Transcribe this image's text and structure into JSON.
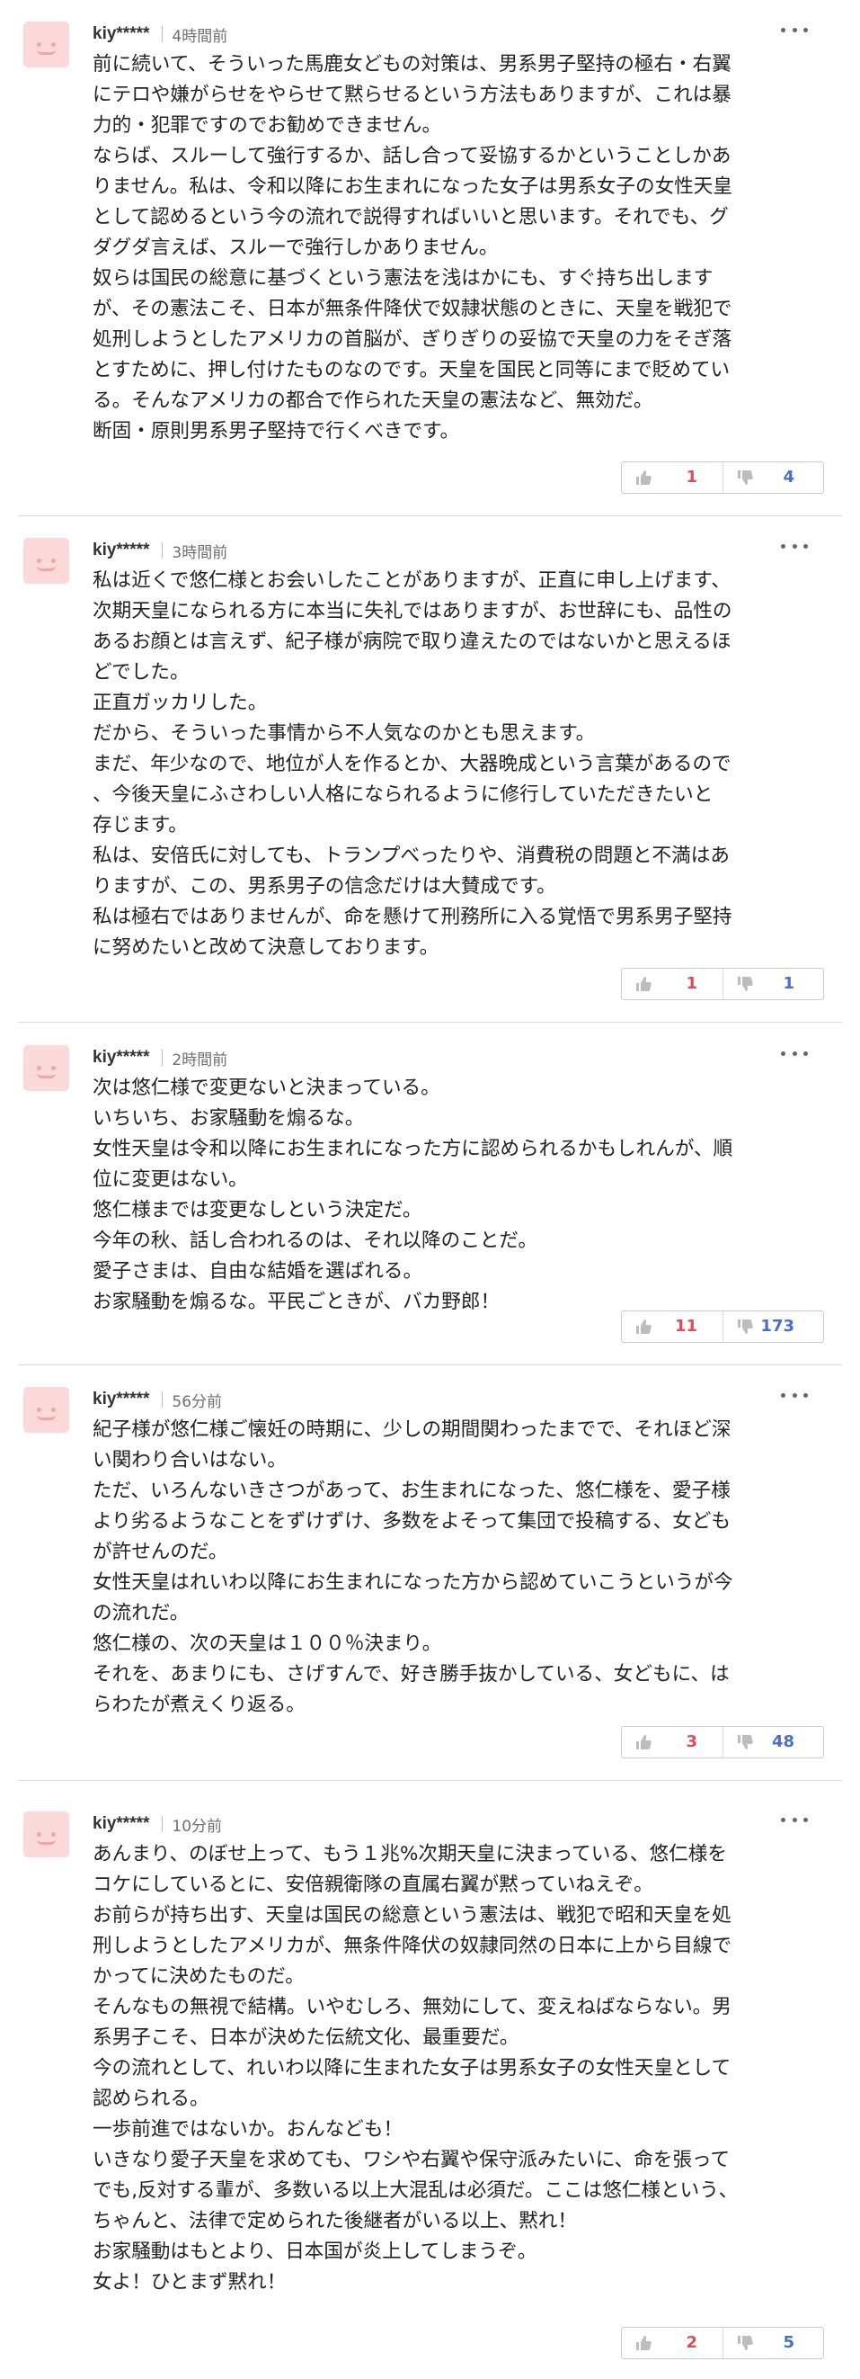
{
  "comments": [
    {
      "author": "kiy*****",
      "time": "4時間前",
      "lines": [
        "前に続いて、そういった馬鹿女どもの対策は、男系男子堅持の極右・右翼",
        "にテロや嫌がらせをやらせて黙らせるという方法もありますが、これは暴",
        "力的・犯罪ですのでお勧めできません。",
        "ならば、スルーして強行するか、話し合って妥協するかということしかあ",
        "りません。私は、令和以降にお生まれになった女子は男系女子の女性天皇",
        "として認めるという今の流れで説得すればいいと思います。それでも、グ",
        "ダグダ言えば、スルーで強行しかありません。",
        "奴らは国民の総意に基づくという憲法を浅はかにも、すぐ持ち出します",
        "が、その憲法こそ、日本が無条件降伏で奴隷状態のときに、天皇を戦犯で",
        "処刑しようとしたアメリカの首脳が、ぎりぎりの妥協で天皇の力をそぎ落",
        "とすために、押し付けたものなのです。天皇を国民と同等にまで貶めてい",
        "る。そんなアメリカの都合で作られた天皇の憲法など、無効だ。",
        "断固・原則男系男子堅持で行くべきです。"
      ],
      "likes": "1",
      "dislikes": "4"
    },
    {
      "author": "kiy*****",
      "time": "3時間前",
      "lines": [
        "私は近くで悠仁様とお会いしたことがありますが、正直に申し上げます、",
        "次期天皇になられる方に本当に失礼ではありますが、お世辞にも、品性の",
        "あるお顔とは言えず、紀子様が病院で取り違えたのではないかと思えるほ",
        "どでした。",
        "正直ガッカリした。",
        "だから、そういった事情から不人気なのかとも思えます。",
        "まだ、年少なので、地位が人を作るとか、大器晩成という言葉があるので",
        "、今後天皇にふさわしい人格になられるように修行していただきたいと",
        "存じます。",
        "私は、安倍氏に対しても、トランプべったりや、消費税の問題と不満はあ",
        "りますが、この、男系男子の信念だけは大賛成です。",
        "私は極右ではありませんが、命を懸けて刑務所に入る覚悟で男系男子堅持",
        "に努めたいと改めて決意しております。"
      ],
      "likes": "1",
      "dislikes": "1"
    },
    {
      "author": "kiy*****",
      "time": "2時間前",
      "lines": [
        "次は悠仁様で変更ないと決まっている。",
        "いちいち、お家騒動を煽るな。",
        "女性天皇は令和以降にお生まれになった方に認められるかもしれんが、順",
        "位に変更はない。",
        "悠仁様までは変更なしという決定だ。",
        "今年の秋、話し合われるのは、それ以降のことだ。",
        "愛子さまは、自由な結婚を選ばれる。",
        "お家騒動を煽るな。平民ごときが、バカ野郎！"
      ],
      "likes": "11",
      "dislikes": "173"
    },
    {
      "author": "kiy*****",
      "time": "56分前",
      "lines": [
        "紀子様が悠仁様ご懐妊の時期に、少しの期間関わったまでで、それほど深",
        "い関わり合いはない。",
        "ただ、いろんないきさつがあって、お生まれになった、悠仁様を、愛子様",
        "より劣るようなことをずけずけ、多数をよそって集団で投稿する、女ども",
        "が許せんのだ。",
        "女性天皇はれいわ以降にお生まれになった方から認めていこうというが今",
        "の流れだ。",
        "悠仁様の、次の天皇は１００％決まり。",
        "それを、あまりにも、さげすんで、好き勝手抜かしている、女どもに、は",
        "らわたが煮えくり返る。"
      ],
      "likes": "3",
      "dislikes": "48"
    },
    {
      "author": "kiy*****",
      "time": "10分前",
      "lines": [
        "あんまり、のぼせ上って、もう１兆%次期天皇に決まっている、悠仁様を",
        "コケにしているとに、安倍親衛隊の直属右翼が黙っていねえぞ。",
        "お前らが持ち出す、天皇は国民の総意という憲法は、戦犯で昭和天皇を処",
        "刑しようとしたアメリカが、無条件降伏の奴隷同然の日本に上から目線で",
        "かってに決めたものだ。",
        "そんなもの無視で結構。いやむしろ、無効にして、変えねばならない。男",
        "系男子こそ、日本が決めた伝統文化、最重要だ。",
        "今の流れとして、れいわ以降に生まれた女子は男系女子の女性天皇として",
        "認められる。",
        "一歩前進ではないか。おんなども！",
        "いきなり愛子天皇を求めても、ワシや右翼や保守派みたいに、命を張って",
        "でも,反対する輩が、多数いる以上大混乱は必須だ。ここは悠仁様という、",
        "ちゃんと、法律で定められた後継者がいる以上、黙れ！",
        "お家騒動はもとより、日本国が炎上してしまうぞ。",
        "女よ！ひとまず黙れ！"
      ],
      "likes": "2",
      "dislikes": "5"
    }
  ]
}
